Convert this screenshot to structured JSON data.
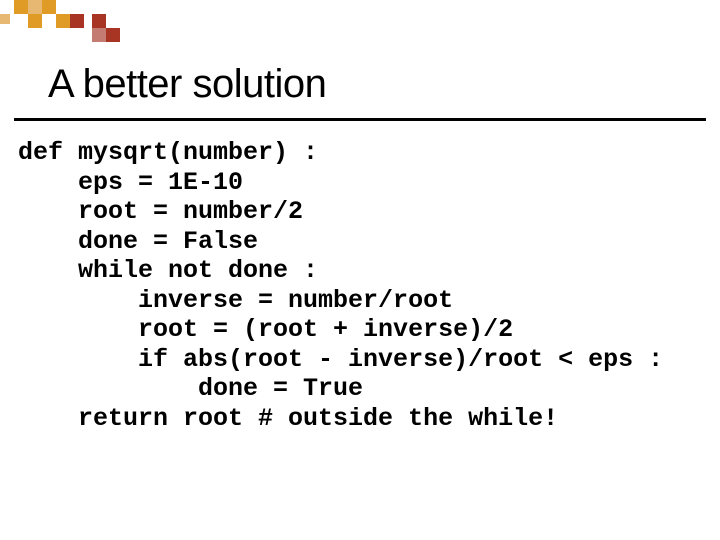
{
  "title": "A better solution",
  "code": {
    "l0": "def mysqrt(number) :",
    "l1": "    eps = 1E-10",
    "l2": "    root = number/2",
    "l3": "    done = False",
    "l4": "    while not done :",
    "l5": "        inverse = number/root",
    "l6": "        root = (root + inverse)/2",
    "l7": "        if abs(root - inverse)/root < eps :",
    "l8": "            done = True",
    "l9": "    return root # outside the while!"
  },
  "deco_colors": {
    "orange": "#e09a26",
    "orange_light": "#e6b872",
    "red_dark": "#a83423",
    "red_light": "#c47b71"
  }
}
